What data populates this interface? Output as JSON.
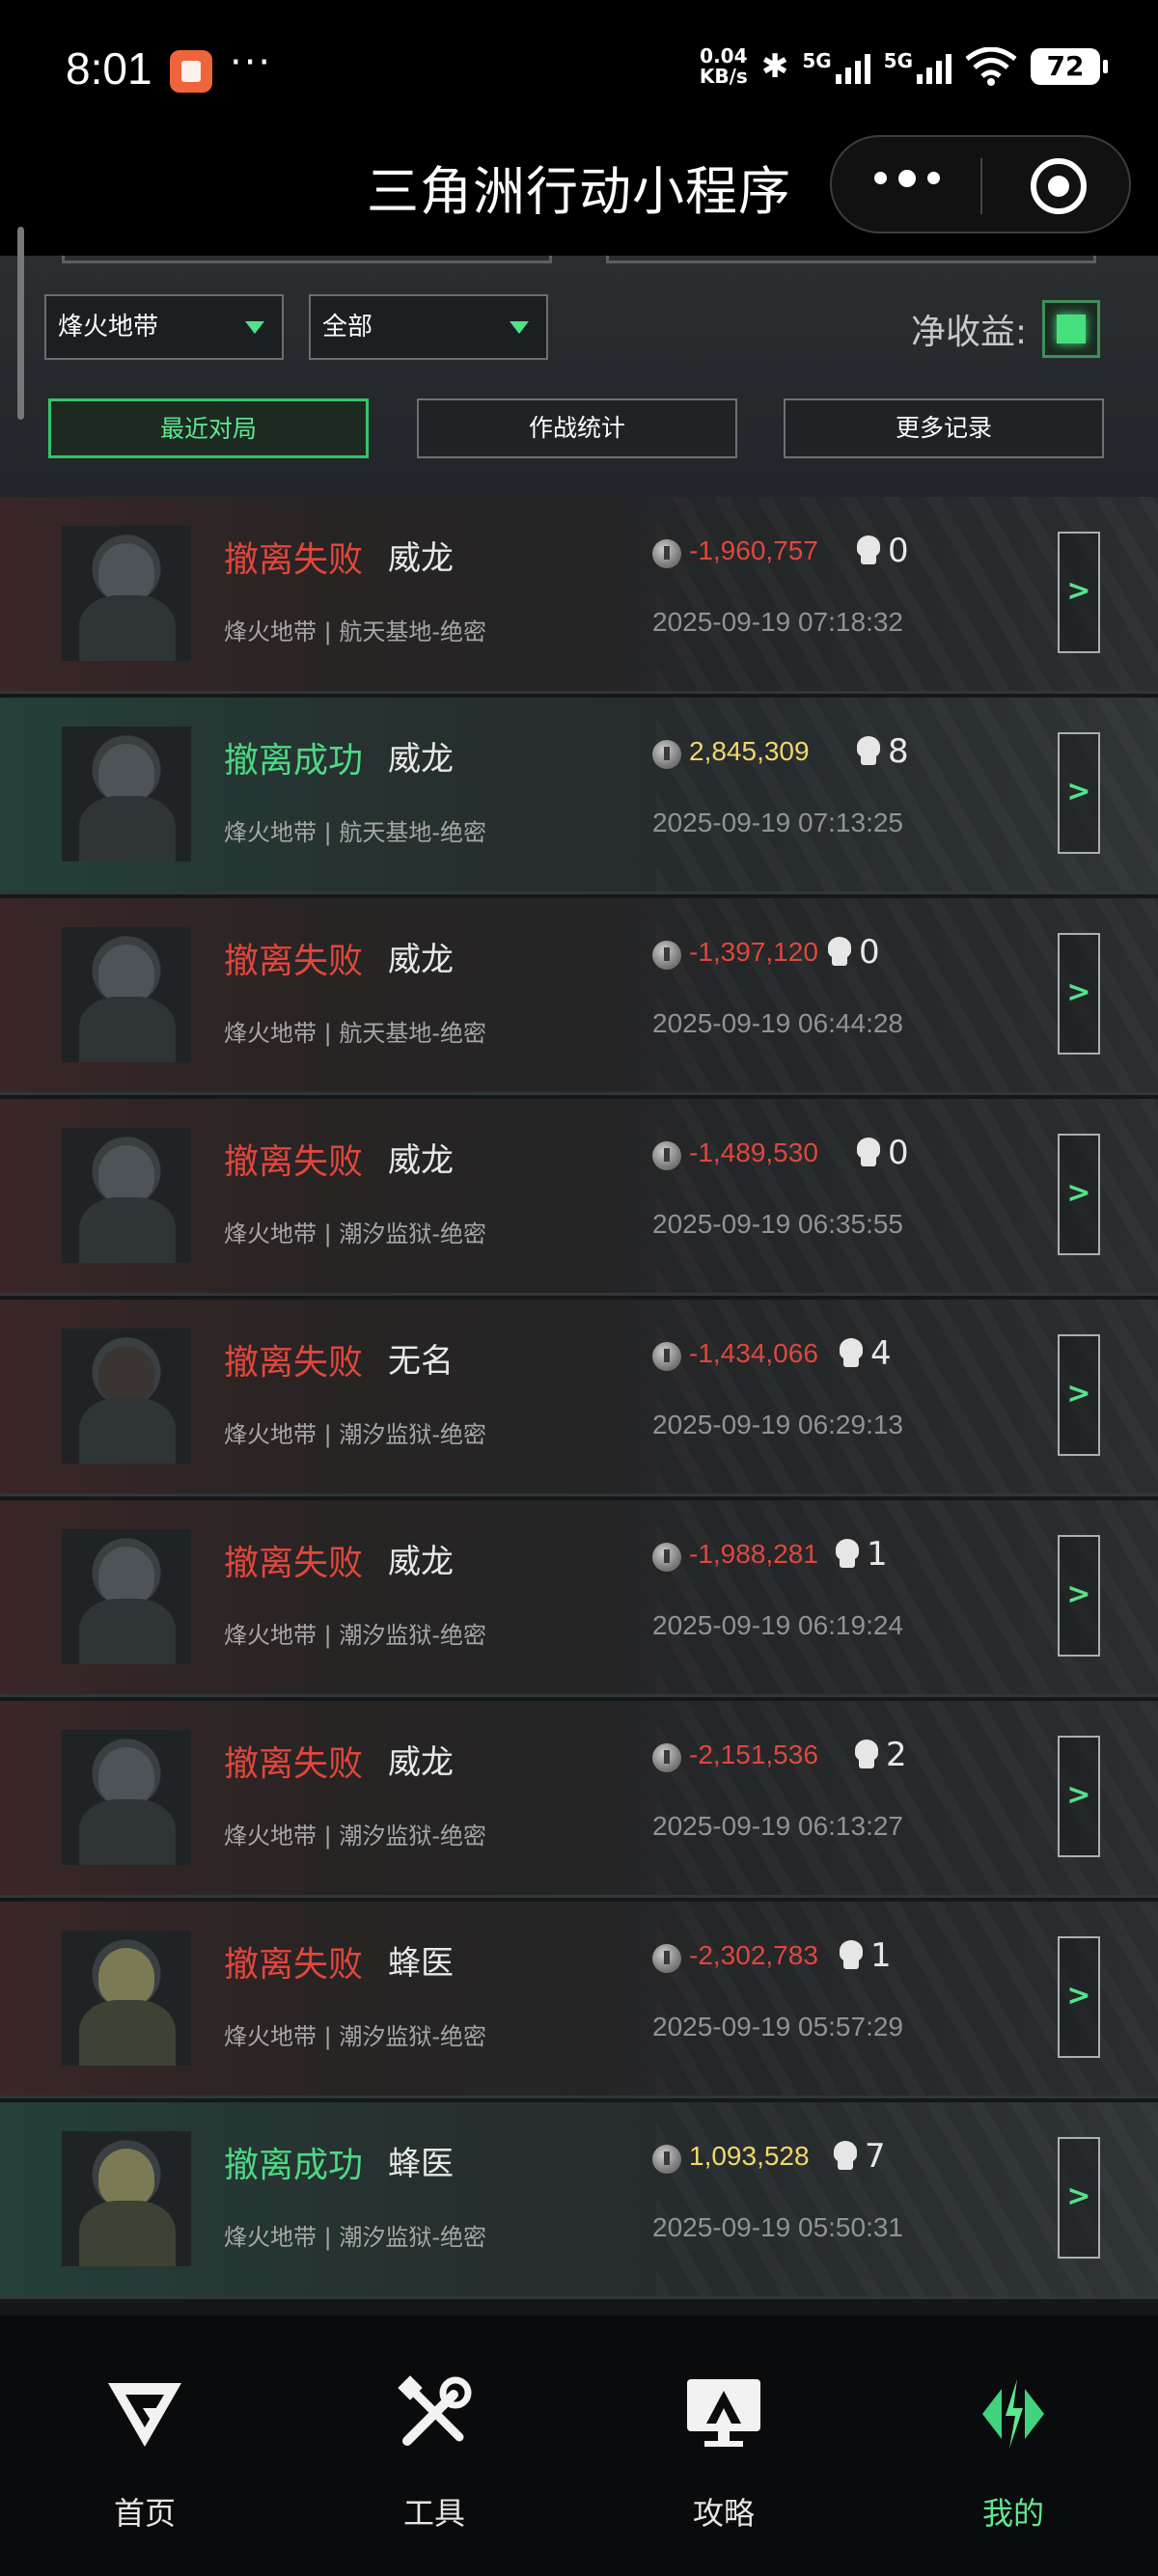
{
  "status_bar": {
    "time": "8:01",
    "more": "···",
    "speed_value": "0.04",
    "speed_unit": "KB/s",
    "network1": "5G",
    "network2": "5G",
    "battery": "72"
  },
  "header": {
    "title": "三角洲行动小程序"
  },
  "filters": {
    "mode": "烽火地带",
    "scope": "全部",
    "net_income_label": "净收益:",
    "tabs": [
      "最近对局",
      "作战统计",
      "更多记录"
    ],
    "active_tab": "最近对局"
  },
  "records": [
    {
      "status": "撤离失败",
      "result": "fail",
      "operator": "威龙",
      "map": "烽火地带 | 航天基地-绝密",
      "income": "-1,960,757",
      "kills": "0",
      "time": "2025-09-19 07:18:32",
      "avatar": "weilong"
    },
    {
      "status": "撤离成功",
      "result": "success",
      "operator": "威龙",
      "map": "烽火地带 | 航天基地-绝密",
      "income": "2,845,309",
      "kills": "8",
      "time": "2025-09-19 07:13:25",
      "avatar": "weilong"
    },
    {
      "status": "撤离失败",
      "result": "fail",
      "operator": "威龙",
      "map": "烽火地带 | 航天基地-绝密",
      "income": "-1,397,120",
      "kills": "0",
      "time": "2025-09-19 06:44:28",
      "avatar": "weilong"
    },
    {
      "status": "撤离失败",
      "result": "fail",
      "operator": "威龙",
      "map": "烽火地带 | 潮汐监狱-绝密",
      "income": "-1,489,530",
      "kills": "0",
      "time": "2025-09-19 06:35:55",
      "avatar": "weilong"
    },
    {
      "status": "撤离失败",
      "result": "fail",
      "operator": "无名",
      "map": "烽火地带 | 潮汐监狱-绝密",
      "income": "-1,434,066",
      "kills": "4",
      "time": "2025-09-19 06:29:13",
      "avatar": "wuming"
    },
    {
      "status": "撤离失败",
      "result": "fail",
      "operator": "威龙",
      "map": "烽火地带 | 潮汐监狱-绝密",
      "income": "-1,988,281",
      "kills": "1",
      "time": "2025-09-19 06:19:24",
      "avatar": "weilong"
    },
    {
      "status": "撤离失败",
      "result": "fail",
      "operator": "威龙",
      "map": "烽火地带 | 潮汐监狱-绝密",
      "income": "-2,151,536",
      "kills": "2",
      "time": "2025-09-19 06:13:27",
      "avatar": "weilong"
    },
    {
      "status": "撤离失败",
      "result": "fail",
      "operator": "蜂医",
      "map": "烽火地带 | 潮汐监狱-绝密",
      "income": "-2,302,783",
      "kills": "1",
      "time": "2025-09-19 05:57:29",
      "avatar": "fengyi"
    },
    {
      "status": "撤离成功",
      "result": "success",
      "operator": "蜂医",
      "map": "烽火地带 | 潮汐监狱-绝密",
      "income": "1,093,528",
      "kills": "7",
      "time": "2025-09-19 05:50:31",
      "avatar": "fengyi"
    }
  ],
  "detail_label": ">",
  "bottom_nav": [
    {
      "label": "首页",
      "icon": "home-icon"
    },
    {
      "label": "工具",
      "icon": "tools-icon"
    },
    {
      "label": "攻略",
      "icon": "guide-icon"
    },
    {
      "label": "我的",
      "icon": "profile-icon",
      "active": true
    }
  ],
  "colors": {
    "accent_green": "#5ee890",
    "fail_red": "#e0473d",
    "success_green": "#4fd884",
    "income_gold": "#f2d76a"
  }
}
